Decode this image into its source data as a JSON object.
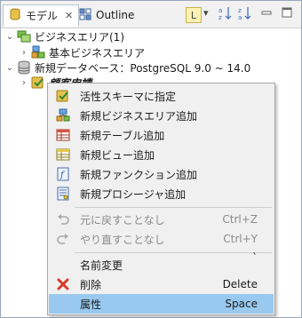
{
  "tabs": [
    {
      "label": "モデル",
      "close": "✕"
    },
    {
      "label": "Outline"
    }
  ],
  "toolbar": {
    "view_icon": "L",
    "dropdown": "▾",
    "sort_az": "a↓z",
    "sort_za": "z↓a",
    "minimize": "—",
    "maximize": "□"
  },
  "tree": {
    "items": [
      {
        "label": "ビジネスエリア(1)",
        "arrow": "⌄"
      },
      {
        "label": "基本ビジネスエリア",
        "arrow": "›"
      },
      {
        "label": "新規データベース：PostgreSQL 9.0 ~ 14.0",
        "arrow": "⌄"
      },
      {
        "label": "顧客申請",
        "arrow": "›"
      }
    ]
  },
  "menu": {
    "items": [
      {
        "label": "活性スキーマに指定",
        "accel": "",
        "icon": "schema-icon",
        "enabled": true
      },
      {
        "label": "新規ビジネスエリア追加",
        "accel": "",
        "icon": "business-area-icon",
        "enabled": true
      },
      {
        "label": "新規テーブル追加",
        "accel": "",
        "icon": "table-icon",
        "enabled": true
      },
      {
        "label": "新規ビュー追加",
        "accel": "",
        "icon": "view-icon",
        "enabled": true
      },
      {
        "label": "新規ファンクション追加",
        "accel": "",
        "icon": "function-icon",
        "enabled": true
      },
      {
        "label": "新規プロシージャ追加",
        "accel": "",
        "icon": "procedure-icon",
        "enabled": true
      },
      {
        "label": "元に戻すことなし",
        "accel": "Ctrl+Z",
        "icon": "undo-icon",
        "enabled": false
      },
      {
        "label": "やり直すことなし",
        "accel": "Ctrl+Y",
        "icon": "redo-icon",
        "enabled": false
      },
      {
        "label": "名前変更",
        "accel": "`",
        "icon": "",
        "enabled": true
      },
      {
        "label": "削除",
        "accel": "Delete",
        "icon": "delete-icon",
        "enabled": true
      },
      {
        "label": "属性",
        "accel": "Space",
        "icon": "",
        "enabled": true,
        "highlighted": true
      }
    ]
  },
  "colors": {
    "highlight": "#99c9ef",
    "menu_bg": "#f0f0f0",
    "delete_red": "#d83a2a"
  }
}
